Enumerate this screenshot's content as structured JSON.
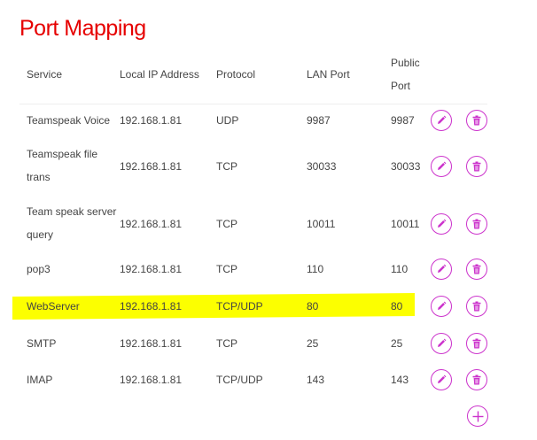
{
  "page": {
    "title": "Port Mapping"
  },
  "colors": {
    "accent": "#cc33cc",
    "title": "#e60000",
    "highlight": "#fcff00"
  },
  "table": {
    "headers": {
      "service": "Service",
      "local_ip": "Local IP Address",
      "protocol": "Protocol",
      "lan_port": "LAN Port",
      "public_port_line1": "Public",
      "public_port_line2": "Port"
    },
    "rows": [
      {
        "service_line1": "Teamspeak Voice",
        "service_line2": "",
        "ip": "192.168.1.81",
        "protocol": "UDP",
        "lan_port": "9987",
        "public_port": "9987",
        "highlighted": false
      },
      {
        "service_line1": "Teamspeak file",
        "service_line2": "trans",
        "ip": "192.168.1.81",
        "protocol": "TCP",
        "lan_port": "30033",
        "public_port": "30033",
        "highlighted": false
      },
      {
        "service_line1": "Team speak server",
        "service_line2": "query",
        "ip": "192.168.1.81",
        "protocol": "TCP",
        "lan_port": "10011",
        "public_port": "10011",
        "highlighted": false
      },
      {
        "service_line1": "pop3",
        "service_line2": "",
        "ip": "192.168.1.81",
        "protocol": "TCP",
        "lan_port": "110",
        "public_port": "110",
        "highlighted": false
      },
      {
        "service_line1": "WebServer",
        "service_line2": "",
        "ip": "192.168.1.81",
        "protocol": "TCP/UDP",
        "lan_port": "80",
        "public_port": "80",
        "highlighted": true
      },
      {
        "service_line1": "SMTP",
        "service_line2": "",
        "ip": "192.168.1.81",
        "protocol": "TCP",
        "lan_port": "25",
        "public_port": "25",
        "highlighted": false
      },
      {
        "service_line1": "IMAP",
        "service_line2": "",
        "ip": "192.168.1.81",
        "protocol": "TCP/UDP",
        "lan_port": "143",
        "public_port": "143",
        "highlighted": false
      }
    ],
    "row_actions": {
      "edit_icon": "pencil-icon",
      "delete_icon": "trash-icon"
    },
    "add_icon": "plus-icon"
  }
}
